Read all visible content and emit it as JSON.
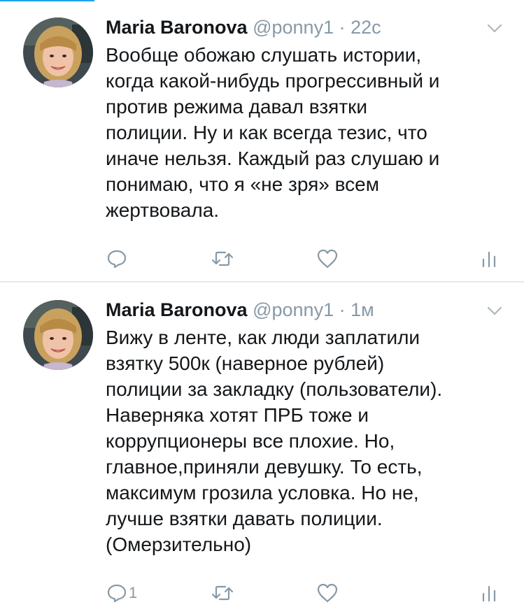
{
  "tweets": [
    {
      "author_name": "Maria Baronova",
      "handle": "@ponny1",
      "separator": "·",
      "time": "22с",
      "text": "Вообще обожаю слушать истории,\nкогда какой-нибудь прогрессивный и\nпротив режима давал взятки\nполиции. Ну и как всегда тезис, что\nиначе нельзя. Каждый раз слушаю и\nпонимаю, что я «не зря» всем\nжертвовала.",
      "reply_count": "",
      "icons": [
        "reply-icon",
        "retweet-icon",
        "heart-icon",
        "stats-icon",
        "chevron-down-icon"
      ]
    },
    {
      "author_name": "Maria Baronova",
      "handle": "@ponny1",
      "separator": "·",
      "time": "1м",
      "text": "Вижу в ленте, как люди заплатили\nвзятку 500к (наверное рублей)\nполиции за закладку (пользователи).\nНаверняка хотят ПРБ тоже и\nкоррупционеры все плохие. Но,\nглавное,приняли девушку. То есть,\nмаксимум грозила условка. Но не,\nлучше взятки давать полиции.\n(Омерзительно)",
      "reply_count": "1",
      "icons": [
        "reply-icon",
        "retweet-icon",
        "heart-icon",
        "stats-icon",
        "chevron-down-icon"
      ]
    }
  ],
  "colors": {
    "accent": "#1da1f2",
    "text": "#14171a",
    "secondary": "#8899a6",
    "divider": "#e1e8ed"
  }
}
